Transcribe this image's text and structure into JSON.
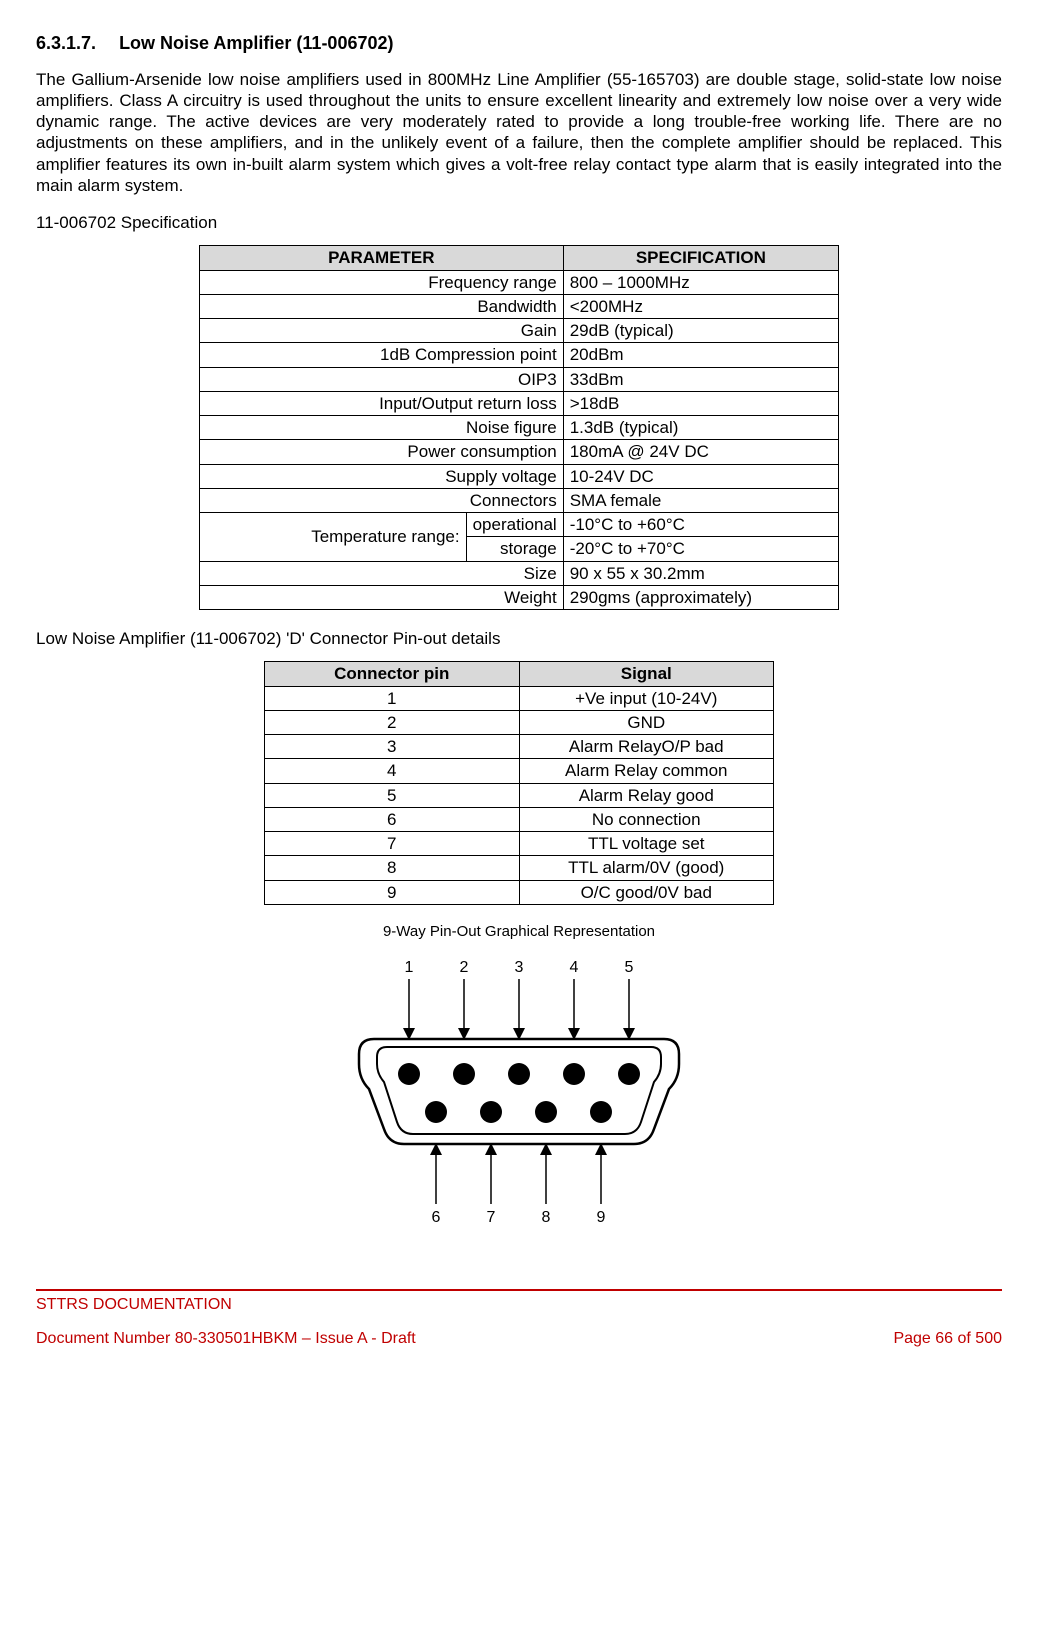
{
  "heading": {
    "number": "6.3.1.7.",
    "title": "Low Noise Amplifier (11-006702)"
  },
  "paragraph": "The Gallium-Arsenide low noise amplifiers used in 800MHz Line Amplifier (55-165703) are double stage, solid-state low noise amplifiers. Class A circuitry is used throughout the units to ensure excellent linearity and extremely low noise over a very wide dynamic range. The active devices are very moderately rated to provide a long trouble-free working life. There are no adjustments on these amplifiers, and in the unlikely event of a failure, then the complete amplifier should be replaced. This amplifier features its own in-built alarm system which gives a volt-free relay contact type alarm that is easily integrated into the main alarm system.",
  "spec_label": "11-006702 Specification",
  "spec_table": {
    "headers": [
      "PARAMETER",
      "SPECIFICATION"
    ],
    "rows": [
      {
        "param": "Frequency range",
        "spec": "800 – 1000MHz"
      },
      {
        "param": "Bandwidth",
        "spec": "<200MHz"
      },
      {
        "param": "Gain",
        "spec": "29dB (typical)"
      },
      {
        "param": "1dB Compression point",
        "spec": "20dBm"
      },
      {
        "param": "OIP3",
        "spec": "33dBm"
      },
      {
        "param": "Input/Output return loss",
        "spec": ">18dB"
      },
      {
        "param": "Noise figure",
        "spec": "1.3dB (typical)"
      },
      {
        "param": "Power consumption",
        "spec": "180mA @ 24V DC"
      },
      {
        "param": "Supply voltage",
        "spec": "10-24V DC"
      },
      {
        "param": "Connectors",
        "spec": "SMA female"
      }
    ],
    "temp_label": "Temperature range:",
    "temp_rows": [
      {
        "param": "operational",
        "spec": "-10°C to +60°C"
      },
      {
        "param": "storage",
        "spec": "-20°C to +70°C"
      }
    ],
    "tail_rows": [
      {
        "param": "Size",
        "spec": "90 x 55 x 30.2mm"
      },
      {
        "param": "Weight",
        "spec": "290gms (approximately)"
      }
    ]
  },
  "pinout_label": "Low Noise Amplifier (11-006702) 'D' Connector Pin-out details",
  "pin_table": {
    "headers": [
      "Connector pin",
      "Signal"
    ],
    "rows": [
      {
        "pin": "1",
        "signal": "+Ve input (10-24V)"
      },
      {
        "pin": "2",
        "signal": "GND"
      },
      {
        "pin": "3",
        "signal": "Alarm RelayO/P bad"
      },
      {
        "pin": "4",
        "signal": "Alarm Relay common"
      },
      {
        "pin": "5",
        "signal": "Alarm Relay good"
      },
      {
        "pin": "6",
        "signal": "No connection"
      },
      {
        "pin": "7",
        "signal": "TTL voltage set"
      },
      {
        "pin": "8",
        "signal": "TTL alarm/0V (good)"
      },
      {
        "pin": "9",
        "signal": "O/C good/0V bad"
      }
    ]
  },
  "diagram": {
    "caption": "9-Way Pin-Out Graphical Representation",
    "top_pins": [
      "1",
      "2",
      "3",
      "4",
      "5"
    ],
    "bottom_pins": [
      "6",
      "7",
      "8",
      "9"
    ]
  },
  "footer": {
    "line1": "STTRS DOCUMENTATION",
    "doc": "Document Number 80-330501HBKM – Issue A - Draft",
    "page": "Page 66 of 500"
  }
}
